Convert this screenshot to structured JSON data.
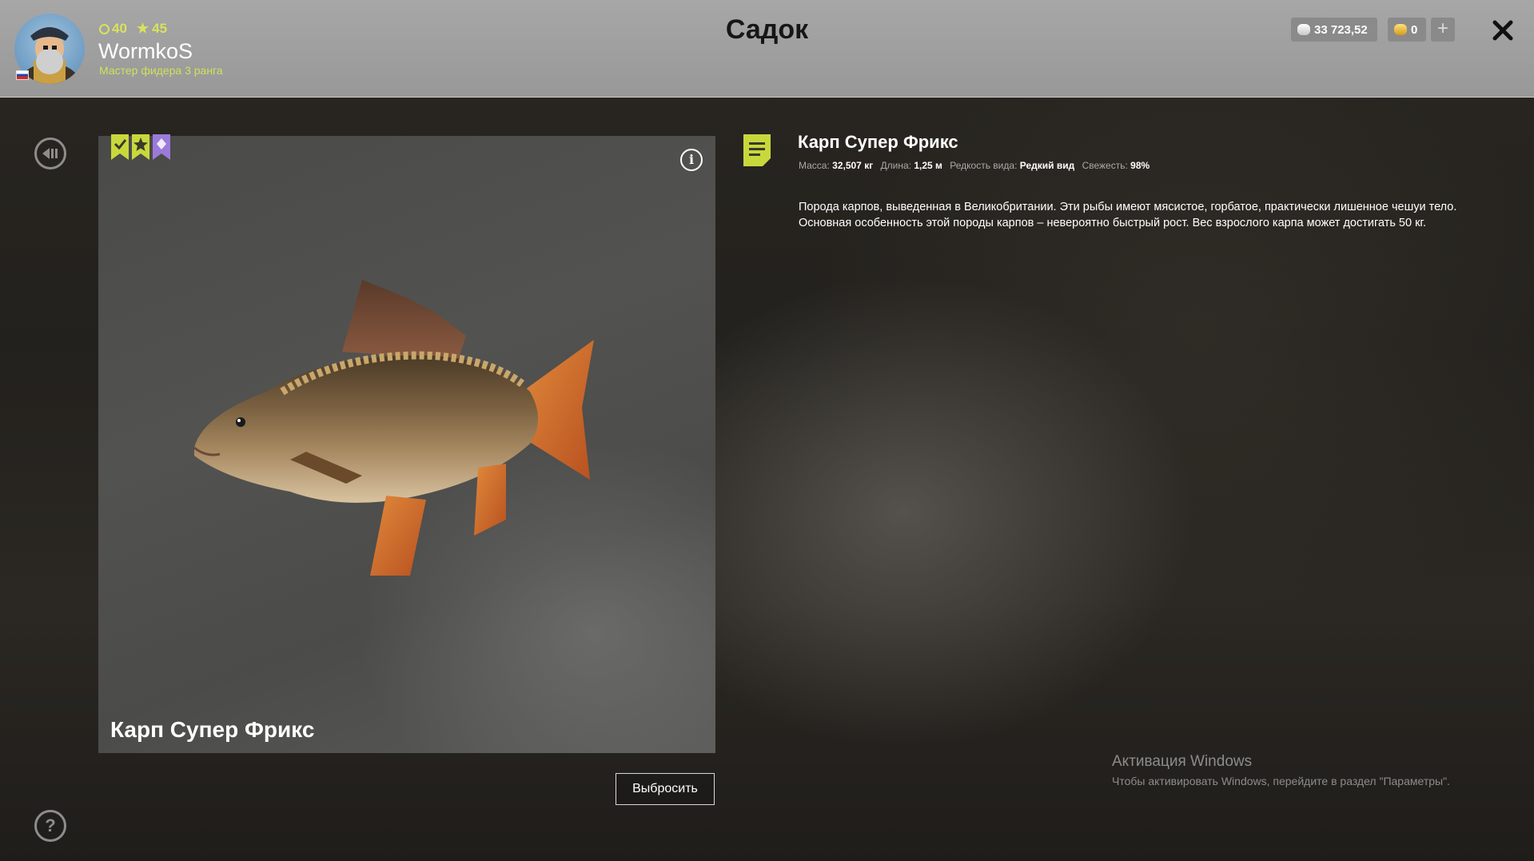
{
  "header": {
    "title": "Садок",
    "player": {
      "level": "40",
      "stars": "45",
      "name": "WormkoS",
      "rank": "Мастер фидера 3 ранга"
    },
    "currency": {
      "silver": "33 723,52",
      "gold": "0",
      "add_label": "+"
    },
    "close_label": "✕"
  },
  "fish": {
    "name": "Карп Супер Фрикс",
    "caption": "Карп Супер Фрикс",
    "meta": {
      "mass_label": "Масса:",
      "mass_value": "32,507 кг",
      "length_label": "Длина:",
      "length_value": "1,25 м",
      "rarity_label": "Редкость вида:",
      "rarity_value": "Редкий вид",
      "freshness_label": "Свежесть:",
      "freshness_value": "98%"
    },
    "description": "Порода карпов, выведенная в Великобритании. Эти рыбы имеют мясистое, горбатое, практически лишенное чешуи тело. Основная особенность этой породы карпов – невероятно быстрый рост. Вес взрослого карпа может достигать 50 кг.",
    "ribbons": [
      {
        "icon": "check-icon",
        "color": "#c8d83c"
      },
      {
        "icon": "star-icon",
        "color": "#c8d83c"
      },
      {
        "icon": "diamond-icon",
        "color": "#9b7bd9"
      }
    ]
  },
  "actions": {
    "discard_label": "Выбросить",
    "info_label": "i",
    "help_label": "?"
  },
  "watermark": {
    "title": "Активация Windows",
    "subtitle": "Чтобы активировать Windows, перейдите в раздел \"Параметры\"."
  },
  "colors": {
    "accent": "#cfe05a",
    "header_bg": "#a2a2a2",
    "panel_bg": "#4d4d4b"
  }
}
